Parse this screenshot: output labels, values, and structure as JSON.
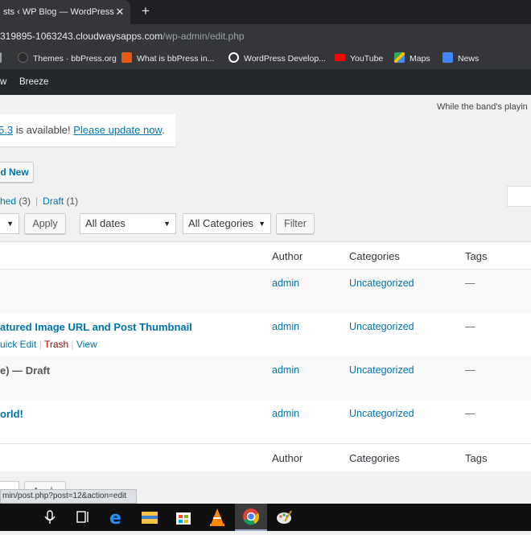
{
  "browser": {
    "tab_title": "sts ‹ WP Blog — WordPress",
    "tab_close": "✕",
    "new_tab": "+",
    "url_host": "319895-1063243.cloudwaysapps.com",
    "url_path": "/wp-admin/edit.php",
    "bookmarks": [
      {
        "label": "",
        "icon_name": "page-icon",
        "color": "#9aa0a6"
      },
      {
        "label": "Themes · bbPress.org",
        "icon_name": "bbpress-icon",
        "color": "#2c2c2c"
      },
      {
        "label": "What is bbPress in...",
        "icon_name": "site-icon",
        "color": "#e55b13"
      },
      {
        "label": "WordPress Develop...",
        "icon_name": "wordpress-icon",
        "color": "#ffffff"
      },
      {
        "label": "YouTube",
        "icon_name": "youtube-icon",
        "color": "#ff0000"
      },
      {
        "label": "Maps",
        "icon_name": "maps-icon",
        "color": "#34a853"
      },
      {
        "label": "News",
        "icon_name": "news-icon",
        "color": "#4285f4"
      }
    ]
  },
  "adminbar": {
    "items": [
      "w",
      "Breeze"
    ]
  },
  "page": {
    "hello_dolly": "While the band's playin",
    "notice": {
      "version": "5.3",
      "text_mid": " is available! ",
      "update_link": "Please update now",
      "text_end": "."
    },
    "add_new": "d New",
    "filters": {
      "published": "hed",
      "published_count": " (3)",
      "sep": "|",
      "draft": "Draft",
      "draft_count": " (1)"
    },
    "bulk": {
      "apply": "Apply",
      "dates": "All dates",
      "categories": "All Categories",
      "filter": "Filter"
    },
    "columns": {
      "author": "Author",
      "categories": "Categories",
      "tags": "Tags"
    },
    "rows": [
      {
        "title": "",
        "author": "admin",
        "category": "Uncategorized",
        "tags": "—",
        "actions": []
      },
      {
        "title": "atured Image URL and Post Thumbnail",
        "author": "admin",
        "category": "Uncategorized",
        "tags": "—",
        "actions": [
          "uick Edit",
          "Trash",
          "View"
        ]
      },
      {
        "title": "e)",
        "state": " — Draft",
        "author": "admin",
        "category": "Uncategorized",
        "tags": "—",
        "actions": []
      },
      {
        "title": "orld!",
        "author": "admin",
        "category": "Uncategorized",
        "tags": "—",
        "actions": []
      }
    ],
    "footer_columns": {
      "author": "Author",
      "categories": "Categories",
      "tags": "Tags"
    },
    "bottom_apply": "Apply"
  },
  "status_tooltip": "min/post.php?post=12&action=edit",
  "taskbar": {
    "icons": [
      "microphone-icon",
      "task-view-icon",
      "edge-icon",
      "file-explorer-icon",
      "store-icon",
      "vlc-icon",
      "chrome-icon",
      "paint-icon"
    ]
  }
}
